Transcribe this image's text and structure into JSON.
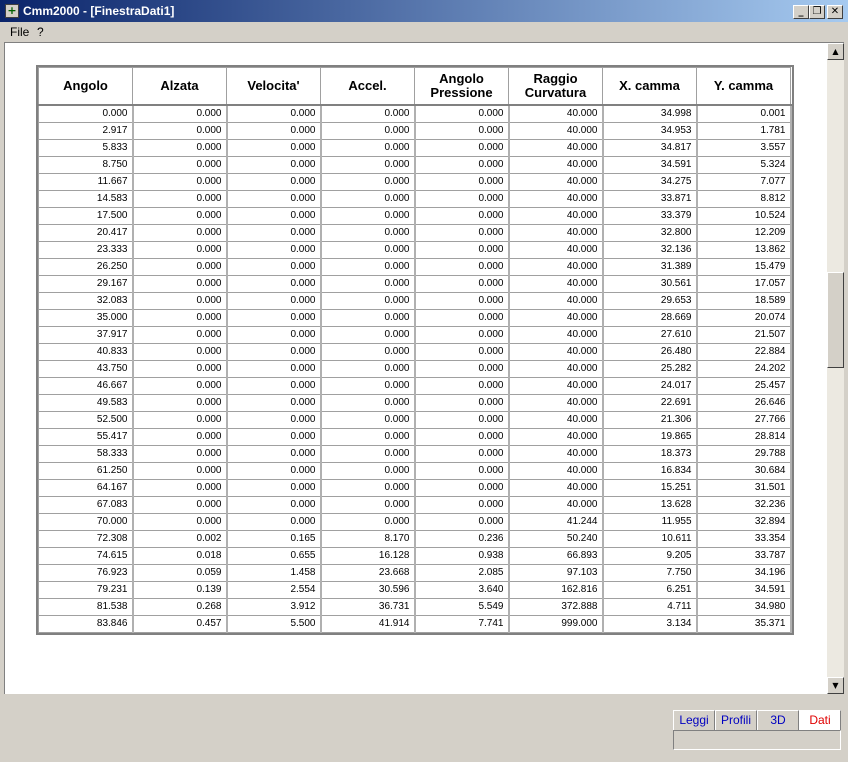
{
  "window": {
    "title": "Cmm2000 - [FinestraDati1]",
    "app_icon_glyph": "+",
    "controls": {
      "minimize": "_",
      "restore": "❐",
      "close": "✕"
    }
  },
  "menu": {
    "items": [
      {
        "label": "File"
      },
      {
        "label": "?"
      }
    ]
  },
  "table": {
    "columns": [
      {
        "label": "Angolo"
      },
      {
        "label": "Alzata"
      },
      {
        "label": "Velocita'"
      },
      {
        "label": "Accel."
      },
      {
        "label": "Angolo\nPressione"
      },
      {
        "label": "Raggio\nCurvatura"
      },
      {
        "label": "X. camma"
      },
      {
        "label": "Y. camma"
      }
    ],
    "rows": [
      [
        "0.000",
        "0.000",
        "0.000",
        "0.000",
        "0.000",
        "40.000",
        "34.998",
        "0.001"
      ],
      [
        "2.917",
        "0.000",
        "0.000",
        "0.000",
        "0.000",
        "40.000",
        "34.953",
        "1.781"
      ],
      [
        "5.833",
        "0.000",
        "0.000",
        "0.000",
        "0.000",
        "40.000",
        "34.817",
        "3.557"
      ],
      [
        "8.750",
        "0.000",
        "0.000",
        "0.000",
        "0.000",
        "40.000",
        "34.591",
        "5.324"
      ],
      [
        "11.667",
        "0.000",
        "0.000",
        "0.000",
        "0.000",
        "40.000",
        "34.275",
        "7.077"
      ],
      [
        "14.583",
        "0.000",
        "0.000",
        "0.000",
        "0.000",
        "40.000",
        "33.871",
        "8.812"
      ],
      [
        "17.500",
        "0.000",
        "0.000",
        "0.000",
        "0.000",
        "40.000",
        "33.379",
        "10.524"
      ],
      [
        "20.417",
        "0.000",
        "0.000",
        "0.000",
        "0.000",
        "40.000",
        "32.800",
        "12.209"
      ],
      [
        "23.333",
        "0.000",
        "0.000",
        "0.000",
        "0.000",
        "40.000",
        "32.136",
        "13.862"
      ],
      [
        "26.250",
        "0.000",
        "0.000",
        "0.000",
        "0.000",
        "40.000",
        "31.389",
        "15.479"
      ],
      [
        "29.167",
        "0.000",
        "0.000",
        "0.000",
        "0.000",
        "40.000",
        "30.561",
        "17.057"
      ],
      [
        "32.083",
        "0.000",
        "0.000",
        "0.000",
        "0.000",
        "40.000",
        "29.653",
        "18.589"
      ],
      [
        "35.000",
        "0.000",
        "0.000",
        "0.000",
        "0.000",
        "40.000",
        "28.669",
        "20.074"
      ],
      [
        "37.917",
        "0.000",
        "0.000",
        "0.000",
        "0.000",
        "40.000",
        "27.610",
        "21.507"
      ],
      [
        "40.833",
        "0.000",
        "0.000",
        "0.000",
        "0.000",
        "40.000",
        "26.480",
        "22.884"
      ],
      [
        "43.750",
        "0.000",
        "0.000",
        "0.000",
        "0.000",
        "40.000",
        "25.282",
        "24.202"
      ],
      [
        "46.667",
        "0.000",
        "0.000",
        "0.000",
        "0.000",
        "40.000",
        "24.017",
        "25.457"
      ],
      [
        "49.583",
        "0.000",
        "0.000",
        "0.000",
        "0.000",
        "40.000",
        "22.691",
        "26.646"
      ],
      [
        "52.500",
        "0.000",
        "0.000",
        "0.000",
        "0.000",
        "40.000",
        "21.306",
        "27.766"
      ],
      [
        "55.417",
        "0.000",
        "0.000",
        "0.000",
        "0.000",
        "40.000",
        "19.865",
        "28.814"
      ],
      [
        "58.333",
        "0.000",
        "0.000",
        "0.000",
        "0.000",
        "40.000",
        "18.373",
        "29.788"
      ],
      [
        "61.250",
        "0.000",
        "0.000",
        "0.000",
        "0.000",
        "40.000",
        "16.834",
        "30.684"
      ],
      [
        "64.167",
        "0.000",
        "0.000",
        "0.000",
        "0.000",
        "40.000",
        "15.251",
        "31.501"
      ],
      [
        "67.083",
        "0.000",
        "0.000",
        "0.000",
        "0.000",
        "40.000",
        "13.628",
        "32.236"
      ],
      [
        "70.000",
        "0.000",
        "0.000",
        "0.000",
        "0.000",
        "41.244",
        "11.955",
        "32.894"
      ],
      [
        "72.308",
        "0.002",
        "0.165",
        "8.170",
        "0.236",
        "50.240",
        "10.611",
        "33.354"
      ],
      [
        "74.615",
        "0.018",
        "0.655",
        "16.128",
        "0.938",
        "66.893",
        "9.205",
        "33.787"
      ],
      [
        "76.923",
        "0.059",
        "1.458",
        "23.668",
        "2.085",
        "97.103",
        "7.750",
        "34.196"
      ],
      [
        "79.231",
        "0.139",
        "2.554",
        "30.596",
        "3.640",
        "162.816",
        "6.251",
        "34.591"
      ],
      [
        "81.538",
        "0.268",
        "3.912",
        "36.731",
        "5.549",
        "372.888",
        "4.711",
        "34.980"
      ],
      [
        "83.846",
        "0.457",
        "5.500",
        "41.914",
        "7.741",
        "999.000",
        "3.134",
        "35.371"
      ]
    ]
  },
  "scrollbar": {
    "up_glyph": "▲",
    "down_glyph": "▼"
  },
  "tabs": [
    {
      "label": "Leggi",
      "color": "#0000c0",
      "active": false
    },
    {
      "label": "Profili",
      "color": "#0000c0",
      "active": false
    },
    {
      "label": "3D",
      "color": "#0000c0",
      "active": false
    },
    {
      "label": "Dati",
      "color": "#e00000",
      "active": true
    }
  ]
}
